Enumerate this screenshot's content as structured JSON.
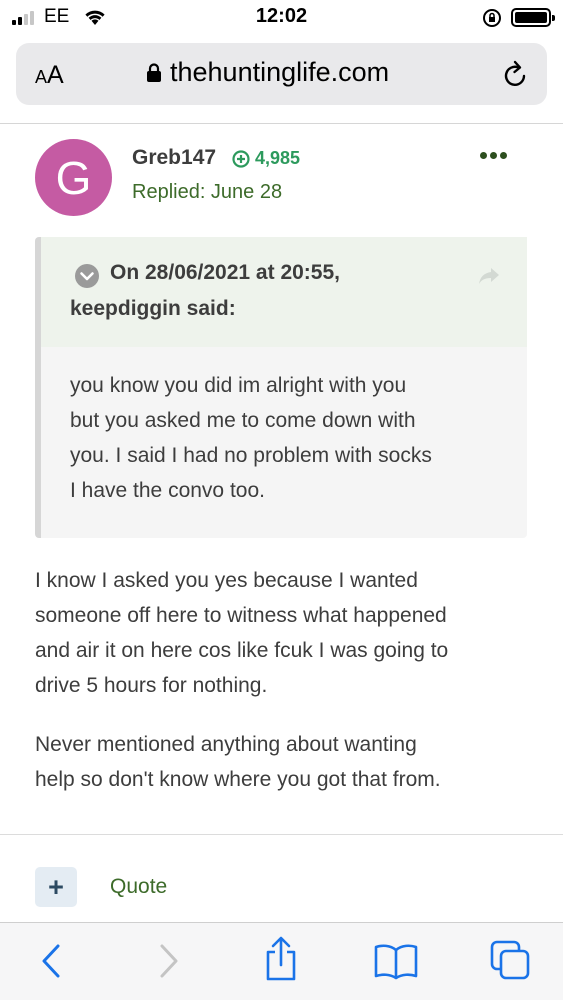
{
  "status": {
    "carrier": "EE",
    "time": "12:02"
  },
  "browser": {
    "aa_small": "A",
    "aa_large": "A",
    "domain": "thehuntinglife.com"
  },
  "post": {
    "avatar_letter": "G",
    "username": "Greb147",
    "reputation": "4,985",
    "replied": "Replied: June 28",
    "quote": {
      "header_line1": "On 28/06/2021 at 20:55,",
      "header_line2": "keepdiggin said:",
      "lines": [
        "you know you did im alright with you",
        "but you asked me to come down with",
        "you. I said I had no problem with socks",
        "I have the convo too."
      ]
    },
    "paragraph1_lines": [
      "I know I asked you yes because I wanted",
      "someone off here to witness what happened",
      "and air it on here cos like fcuk I was going to",
      "drive 5 hours for nothing."
    ],
    "paragraph2_lines": [
      "Never mentioned anything about wanting",
      "help so don't know where you got that from."
    ]
  },
  "actions": {
    "plus_label": "+",
    "quote_label": "Quote"
  },
  "colors": {
    "avatar_bg": "#c55ba3",
    "reputation_green": "#2d9a5d",
    "link_green": "#3d6b2a",
    "toolbar_blue": "#1a73e8"
  },
  "toolbar_icons": [
    "back-icon",
    "forward-icon",
    "share-icon",
    "bookmarks-icon",
    "tabs-icon"
  ]
}
